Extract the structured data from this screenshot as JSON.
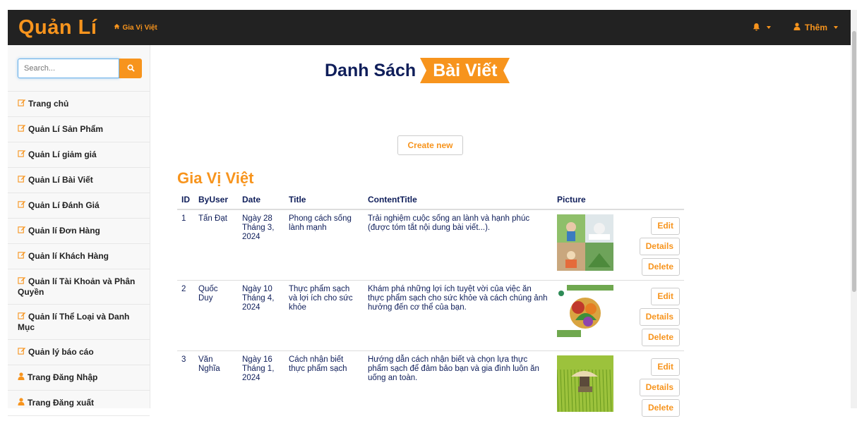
{
  "navbar": {
    "brand": "Quản Lí",
    "home_link": "Gia Vị Việt",
    "more_label": "Thêm"
  },
  "sidebar": {
    "search_placeholder": "Search...",
    "items": [
      {
        "label": "Trang chủ",
        "icon": "edit-icon"
      },
      {
        "label": "Quản Lí Sản Phẩm",
        "icon": "edit-icon"
      },
      {
        "label": "Quản Lí giảm giá",
        "icon": "edit-icon"
      },
      {
        "label": "Quản Lí Bài Viết",
        "icon": "edit-icon"
      },
      {
        "label": "Quản Lí Đánh Giá",
        "icon": "edit-icon"
      },
      {
        "label": "Quản lí Đơn Hàng",
        "icon": "edit-icon"
      },
      {
        "label": "Quản lí Khách Hàng",
        "icon": "edit-icon"
      },
      {
        "label": "Quản lí Tài Khoản và Phân Quyền",
        "icon": "edit-icon"
      },
      {
        "label": "Quản lí Thể Loại và Danh Mục",
        "icon": "edit-icon"
      },
      {
        "label": "Quản lý báo cáo",
        "icon": "edit-icon"
      },
      {
        "label": "Trang Đăng Nhập",
        "icon": "user-icon"
      },
      {
        "label": "Trang Đăng xuất",
        "icon": "user-icon"
      }
    ]
  },
  "page": {
    "title_part1": "Danh Sách",
    "title_part2": "Bài Viết",
    "create_label": "Create new",
    "section_title": "Gia Vị Việt"
  },
  "table": {
    "headers": [
      "ID",
      "ByUser",
      "Date",
      "Title",
      "ContentTitle",
      "Picture"
    ],
    "rows": [
      {
        "id": "1",
        "user": "Tấn Đạt",
        "date": "Ngày 28 Tháng 3, 2024",
        "title": "Phong cách sống lành mạnh",
        "content": "Trải nghiệm cuộc sống an lành và hạnh phúc (được tóm tắt nội dung bài viết...).",
        "picture": "healthy-lifestyle-collage"
      },
      {
        "id": "2",
        "user": "Quốc Duy",
        "date": "Ngày 10 Tháng 4, 2024",
        "title": "Thực phẩm sạch và lợi ích cho sức khỏe",
        "content": "Khám phá những lợi ích tuyệt vời của việc ăn thực phẩm sạch cho sức khỏe và cách chúng ảnh hưởng đến cơ thể của bạn.",
        "picture": "clean-food-vegetables"
      },
      {
        "id": "3",
        "user": "Văn Nghĩa",
        "date": "Ngày 16 Tháng 1, 2024",
        "title": "Cách nhận biết thực phẩm sạch",
        "content": "Hướng dẫn cách nhận biết và chọn lựa thực phẩm sạch để đảm bảo bạn và gia đình luôn ăn uống an toàn.",
        "picture": "rice-field-farmer"
      }
    ],
    "actions": {
      "edit": "Edit",
      "details": "Details",
      "delete": "Delete"
    }
  },
  "colors": {
    "accent": "#f7941d",
    "navbar": "#222222",
    "heading": "#0f1e5a"
  }
}
